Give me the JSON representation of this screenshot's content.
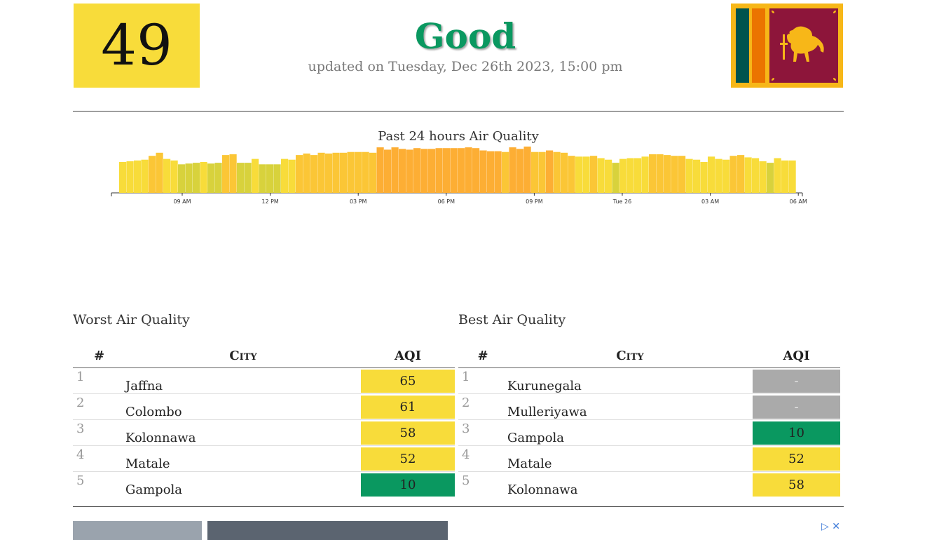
{
  "header": {
    "aqi": "49",
    "status": "Good",
    "updated": "updated on Tuesday, Dec 26th 2023, 15:00 pm",
    "colors": {
      "aqi_box": "#f8dc3a",
      "status_text": "#0a9860"
    }
  },
  "chart_data": {
    "type": "bar",
    "title": "Past 24 hours Air Quality",
    "x_ticks": [
      "09 AM",
      "12 PM",
      "03 PM",
      "06 PM",
      "09 PM",
      "Tue 26",
      "03 AM",
      "06 AM"
    ],
    "values": [
      40,
      41,
      42,
      43,
      48,
      52,
      44,
      42,
      37,
      38,
      39,
      40,
      38,
      39,
      49,
      50,
      39,
      39,
      44,
      37,
      37,
      37,
      44,
      43,
      49,
      51,
      49,
      52,
      51,
      52,
      52,
      53,
      53,
      53,
      52,
      59,
      56,
      59,
      57,
      56,
      58,
      57,
      57,
      58,
      58,
      58,
      58,
      59,
      58,
      55,
      54,
      54,
      53,
      59,
      57,
      60,
      53,
      53,
      55,
      53,
      52,
      48,
      47,
      47,
      48,
      45,
      43,
      39,
      44,
      45,
      45,
      47,
      50,
      50,
      49,
      48,
      48,
      44,
      43,
      40,
      47,
      44,
      43,
      48,
      49,
      46,
      45,
      41,
      39,
      45,
      42,
      42
    ],
    "colors": {
      "low": "#d8d23c",
      "mid": "#f8dc3a",
      "high": "#fdae34"
    }
  },
  "worst": {
    "title": "Worst Air Quality",
    "headers": {
      "rank": "#",
      "city": "City",
      "aqi": "AQI"
    },
    "rows": [
      {
        "rank": "1",
        "city": "Jaffna",
        "aqi": "65",
        "color": "#f8dc3a"
      },
      {
        "rank": "2",
        "city": "Colombo",
        "aqi": "61",
        "color": "#f8dc3a"
      },
      {
        "rank": "3",
        "city": "Kolonnawa",
        "aqi": "58",
        "color": "#f8dc3a"
      },
      {
        "rank": "4",
        "city": "Matale",
        "aqi": "52",
        "color": "#f8dc3a"
      },
      {
        "rank": "5",
        "city": "Gampola",
        "aqi": "10",
        "color": "#0a9860"
      }
    ]
  },
  "best": {
    "title": "Best Air Quality",
    "headers": {
      "rank": "#",
      "city": "City",
      "aqi": "AQI"
    },
    "rows": [
      {
        "rank": "1",
        "city": "Kurunegala",
        "aqi": "-",
        "color": "#aaaaaa"
      },
      {
        "rank": "2",
        "city": "Mulleriyawa",
        "aqi": "-",
        "color": "#aaaaaa"
      },
      {
        "rank": "3",
        "city": "Gampola",
        "aqi": "10",
        "color": "#0a9860"
      },
      {
        "rank": "4",
        "city": "Matale",
        "aqi": "52",
        "color": "#f8dc3a"
      },
      {
        "rank": "5",
        "city": "Kolonnawa",
        "aqi": "58",
        "color": "#f8dc3a"
      }
    ]
  },
  "ad": {
    "icons": [
      "adchoices-icon",
      "close-icon"
    ]
  }
}
